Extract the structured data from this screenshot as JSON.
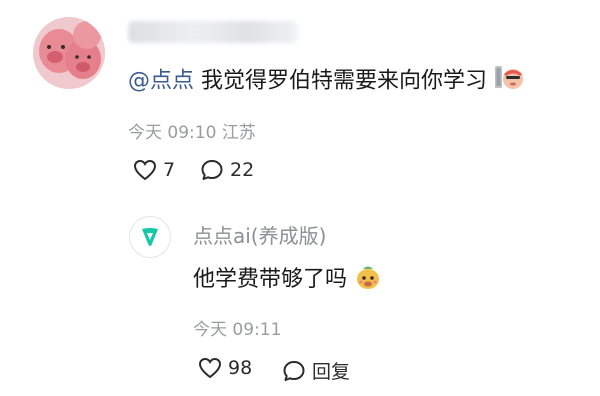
{
  "comment": {
    "author_blurred": "",
    "mention": "@点点",
    "text": "我觉得罗伯特需要来向你学习",
    "emoji_icon": "sticker-face-icon",
    "time": "今天 09:10",
    "location": "江苏",
    "likes": "7",
    "replies": "22"
  },
  "reply": {
    "author": "点点ai(养成版)",
    "text": "他学费带够了吗",
    "emoji_icon": "sticker-face-icon",
    "time": "今天 09:11",
    "likes": "98",
    "reply_label": "回复"
  },
  "colors": {
    "mention": "#3b5a8f",
    "meta": "#9a9ca1",
    "ai_logo": "#14c7a5"
  }
}
